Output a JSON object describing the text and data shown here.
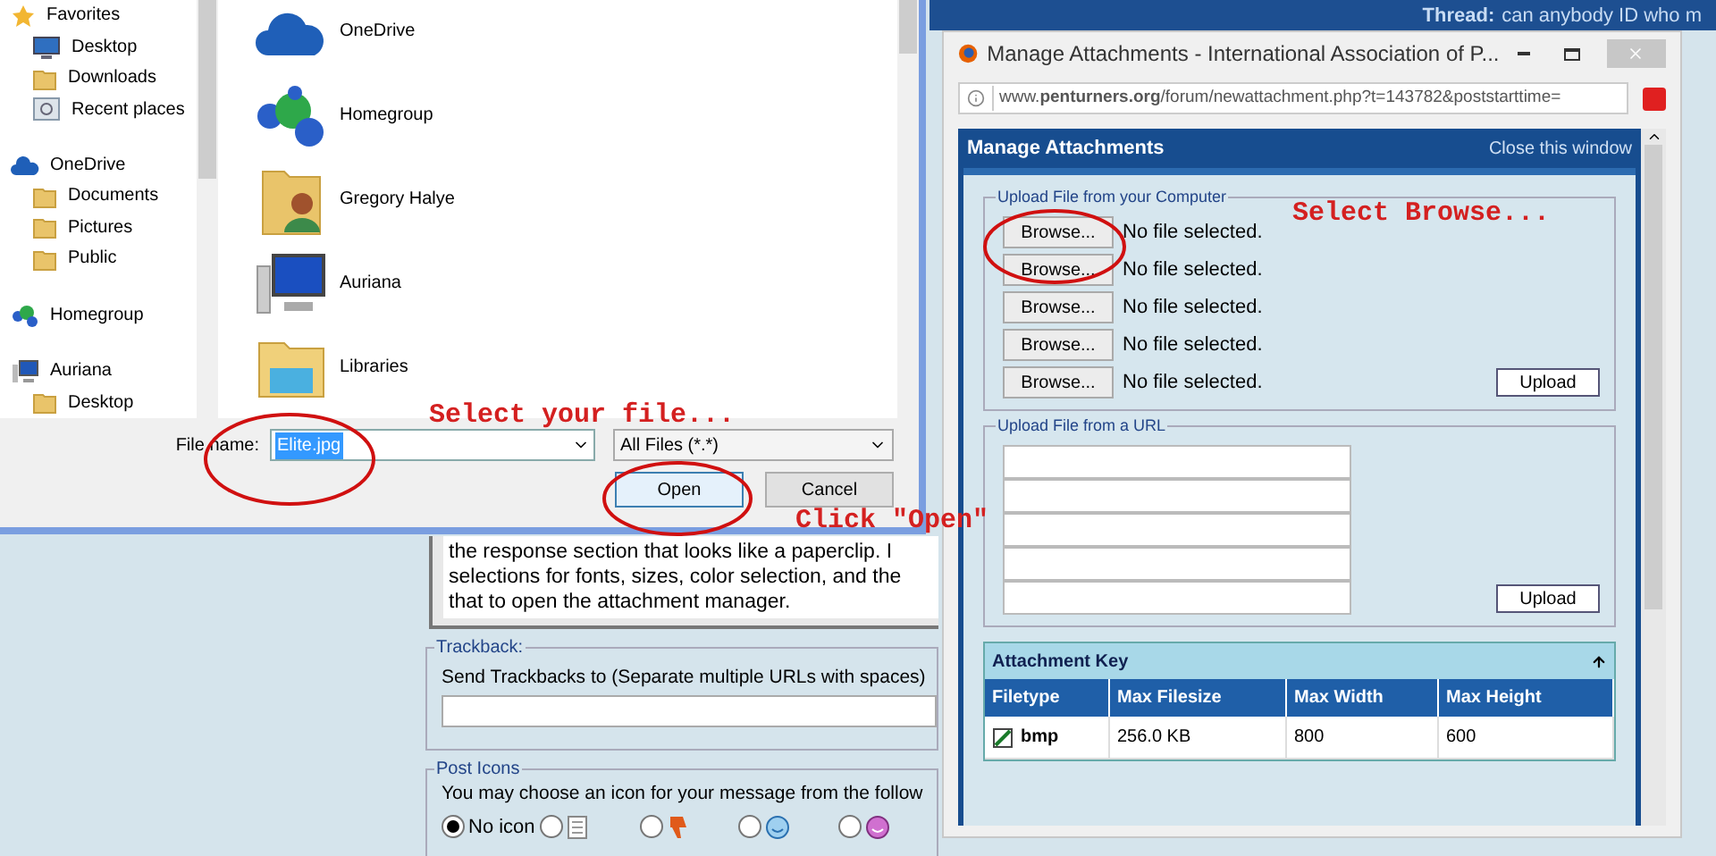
{
  "forum": {
    "thread_label": "Thread:",
    "thread_title": "can anybody ID who m",
    "message_lines": [
      "the response section that looks like a paperclip.  I",
      "selections for fonts, sizes, color selection, and the",
      "that to open the attachment manager."
    ],
    "trackback": {
      "legend": "Trackback:",
      "label": "Send Trackbacks to (Separate multiple URLs with spaces)"
    },
    "post_icons": {
      "legend": "Post Icons",
      "hint": "You may choose an icon for your message from the follow",
      "options": [
        {
          "label": "No icon",
          "kind": "none",
          "selected": true
        },
        {
          "kind": "document",
          "selected": false
        },
        {
          "kind": "thumbs-down",
          "selected": false
        },
        {
          "kind": "smiley",
          "selected": false
        },
        {
          "kind": "purple-smiley",
          "selected": false
        }
      ]
    }
  },
  "file_dialog": {
    "nav_items": [
      {
        "label": "Favorites",
        "kind": "star",
        "group": true
      },
      {
        "label": "Desktop",
        "kind": "monitor",
        "group": false
      },
      {
        "label": "Downloads",
        "kind": "folder",
        "group": false
      },
      {
        "label": "Recent places",
        "kind": "recent",
        "group": false
      },
      {
        "label": "OneDrive",
        "kind": "cloud",
        "group": true
      },
      {
        "label": "Documents",
        "kind": "folder",
        "group": false
      },
      {
        "label": "Pictures",
        "kind": "folder",
        "group": false
      },
      {
        "label": "Public",
        "kind": "folder",
        "group": false
      },
      {
        "label": "Homegroup",
        "kind": "homegroup",
        "group": true
      },
      {
        "label": "Auriana",
        "kind": "computer",
        "group": true
      },
      {
        "label": "Desktop",
        "kind": "folder",
        "group": false
      }
    ],
    "items": [
      {
        "label": "OneDrive",
        "kind": "cloud"
      },
      {
        "label": "Homegroup",
        "kind": "homegroup"
      },
      {
        "label": "Gregory Halye",
        "kind": "user-folder"
      },
      {
        "label": "Auriana",
        "kind": "computer"
      },
      {
        "label": "Libraries",
        "kind": "library"
      }
    ],
    "file_name_label": "File name:",
    "file_name": "Elite.jpg",
    "file_type": "All Files (*.*)",
    "open_button": "Open",
    "cancel_button": "Cancel"
  },
  "attachments_window": {
    "title": "Manage Attachments - International Association of P...",
    "url": "www.**penturners.org**/forum/newattachment.php?t=143782&poststarttime=",
    "header": "Manage Attachments",
    "close_link": "Close this window",
    "computer_legend": "Upload File from your Computer",
    "file_rows": [
      {
        "button": "Browse...",
        "status": "No file selected."
      },
      {
        "button": "Browse...",
        "status": "No file selected."
      },
      {
        "button": "Browse...",
        "status": "No file selected."
      },
      {
        "button": "Browse...",
        "status": "No file selected."
      },
      {
        "button": "Browse...",
        "status": "No file selected."
      }
    ],
    "upload_button": "Upload",
    "url_legend": "Upload File from a URL",
    "url_field_count_rows": [
      "",
      "",
      "",
      "",
      ""
    ],
    "url_upload_button": "Upload",
    "key_title": "Attachment Key",
    "columns": [
      "Filetype",
      "Max Filesize",
      "Max Width",
      "Max Height"
    ],
    "rows": [
      [
        "bmp",
        "256.0 KB",
        "800",
        "600"
      ]
    ]
  },
  "annotations": [
    {
      "text": "Select your file..."
    },
    {
      "text": "Select Browse..."
    },
    {
      "text": "Click \"Open\""
    }
  ]
}
